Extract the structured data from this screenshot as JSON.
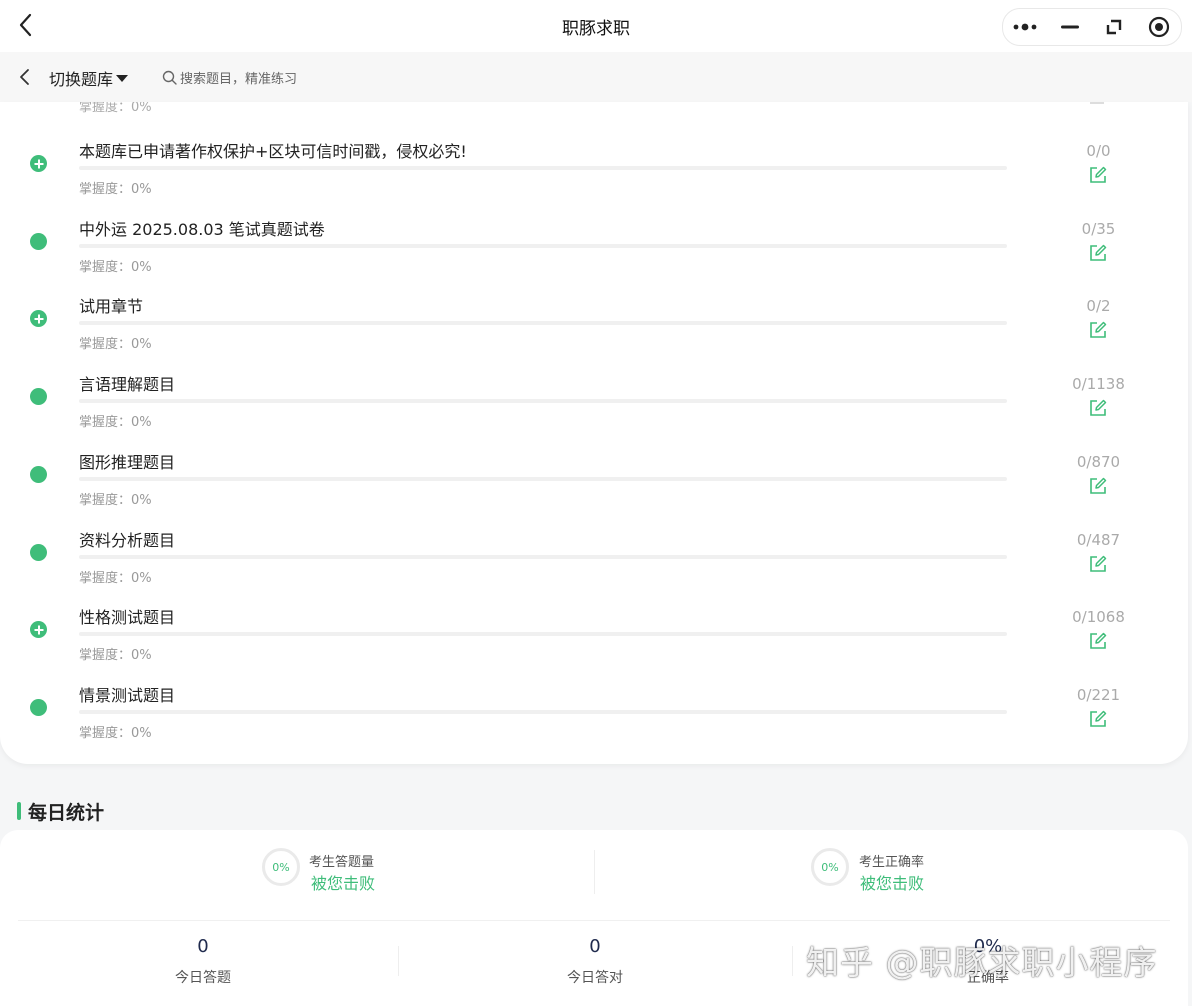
{
  "topbar": {
    "title": "职豚求职"
  },
  "subbar": {
    "switch_label": "切换题库",
    "search_placeholder": "搜索题目，精准练习"
  },
  "list": {
    "cut_row_mastery": "掌握度：0%",
    "rows": [
      {
        "title": "本题库已申请著作权保护+区块可信时间戳，侵权必究!",
        "mastery": "掌握度：0%",
        "count": "0/0",
        "progress": 0,
        "icon": "plus-circle-icon"
      },
      {
        "title": "中外运 2025.08.03 笔试真题试卷",
        "mastery": "掌握度：0%",
        "count": "0/35",
        "progress": 0,
        "icon": "dot-icon"
      },
      {
        "title": "试用章节",
        "mastery": "掌握度：0%",
        "count": "0/2",
        "progress": 0,
        "icon": "plus-circle-icon"
      },
      {
        "title": "言语理解题目",
        "mastery": "掌握度：0%",
        "count": "0/1138",
        "progress": 0,
        "icon": "dot-icon"
      },
      {
        "title": "图形推理题目",
        "mastery": "掌握度：0%",
        "count": "0/870",
        "progress": 0,
        "icon": "dot-icon"
      },
      {
        "title": "资料分析题目",
        "mastery": "掌握度：0%",
        "count": "0/487",
        "progress": 0,
        "icon": "dot-icon"
      },
      {
        "title": "性格测试题目",
        "mastery": "掌握度：0%",
        "count": "0/1068",
        "progress": 0,
        "icon": "plus-circle-icon"
      },
      {
        "title": "情景测试题目",
        "mastery": "掌握度：0%",
        "count": "0/221",
        "progress": 0,
        "icon": "dot-icon"
      }
    ]
  },
  "stats": {
    "title": "每日统计",
    "left": {
      "percent": "0%",
      "label": "考生答题量",
      "link": "被您击败"
    },
    "right": {
      "percent": "0%",
      "label": "考生正确率",
      "link": "被您击败"
    },
    "metrics": [
      {
        "value": "0",
        "label": "今日答题"
      },
      {
        "value": "0",
        "label": "今日答对"
      },
      {
        "value": "0%",
        "label": "正确率"
      }
    ]
  },
  "watermark": "知乎 @职豚求职小程序",
  "colors": {
    "accent": "#3fbd7a",
    "text": "#222222",
    "muted": "#999999"
  }
}
